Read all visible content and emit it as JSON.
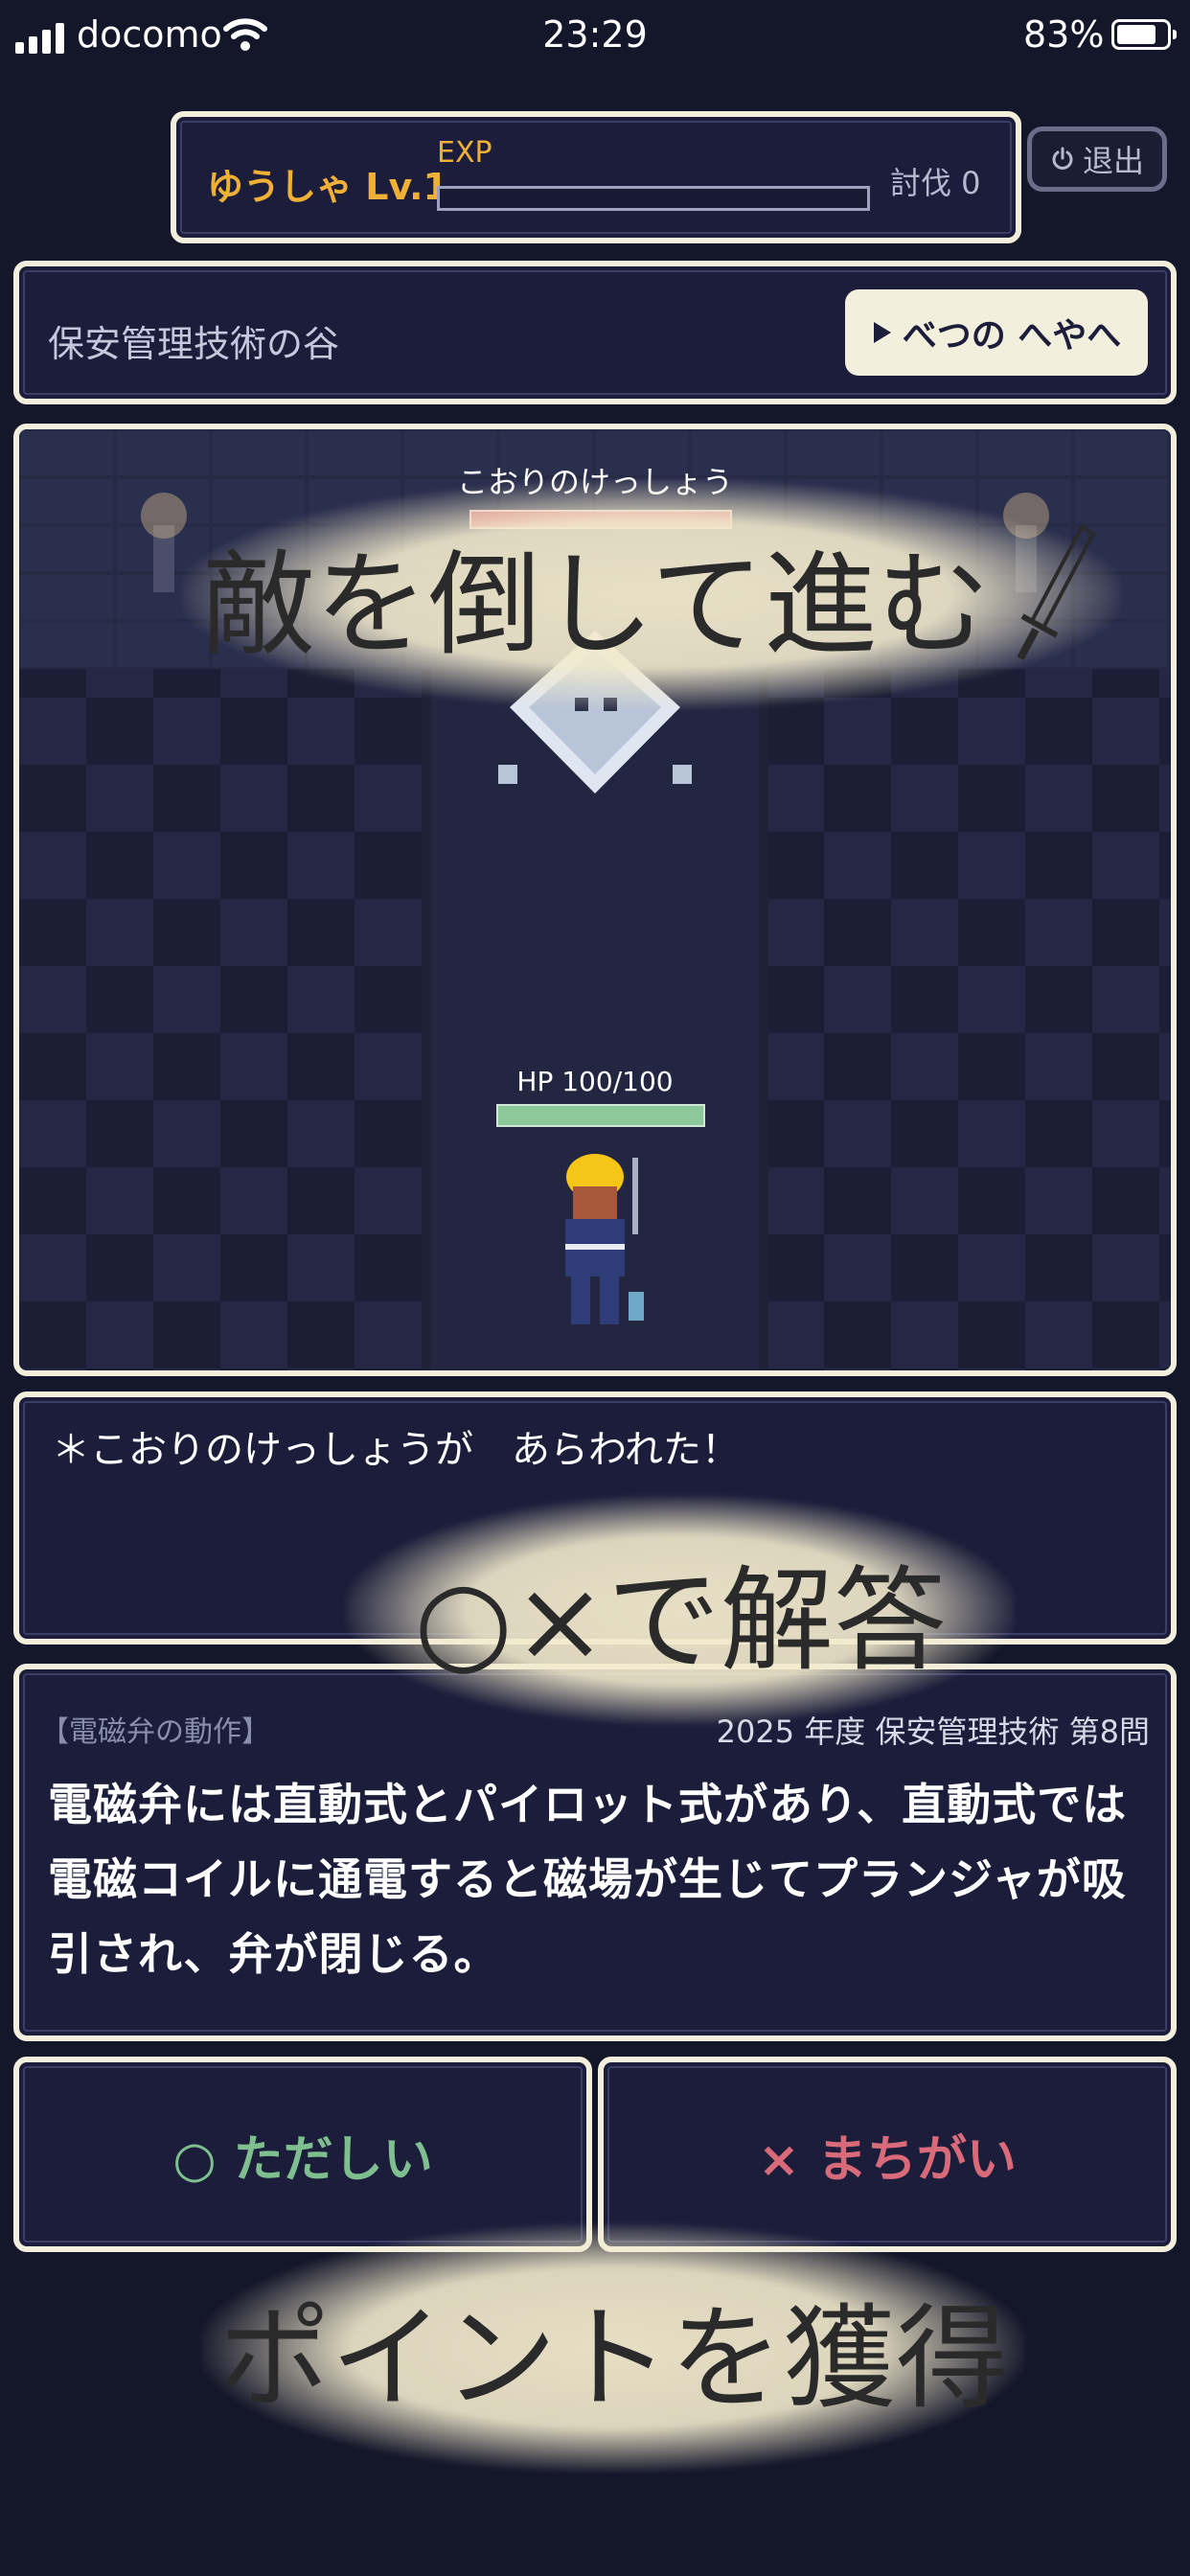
{
  "status_bar": {
    "carrier": "docomo",
    "time": "23:29",
    "battery": "83%"
  },
  "header": {
    "player_name": "ゆうしゃ Lv.1",
    "exp_label": "EXP",
    "exp_progress": 0,
    "kill_count": "討伐 0",
    "exit_label": "退出"
  },
  "area": {
    "name": "保安管理技術の谷",
    "next_room_label": "べつの へやへ"
  },
  "battle": {
    "enemy_name": "こおりのけっしょう",
    "enemy_hp_fraction": 1.0,
    "player_hp_label": "HP 100/100",
    "player_hp_fraction": 1.0
  },
  "message": "＊こおりのけっしょうが　あらわれた！",
  "question": {
    "category": "【電磁弁の動作】",
    "source": "2025 年度 保安管理技術 第8問",
    "text": "電磁弁には直動式とパイロット式があり、直動式では電磁コイルに通電すると磁場が生じてプランジャが吸引され、弁が閉じる。"
  },
  "answers": {
    "correct": "○ ただしい",
    "wrong": "× まちがい"
  },
  "callouts": {
    "battle": "敵を倒して進む",
    "answer": "○×で解答",
    "points": "ポイントを獲得"
  },
  "colors": {
    "background": "#14162a",
    "frame": "#f3efdd",
    "gold": "#f0b035",
    "correct": "#7fbf8f",
    "wrong": "#d86a7a"
  }
}
